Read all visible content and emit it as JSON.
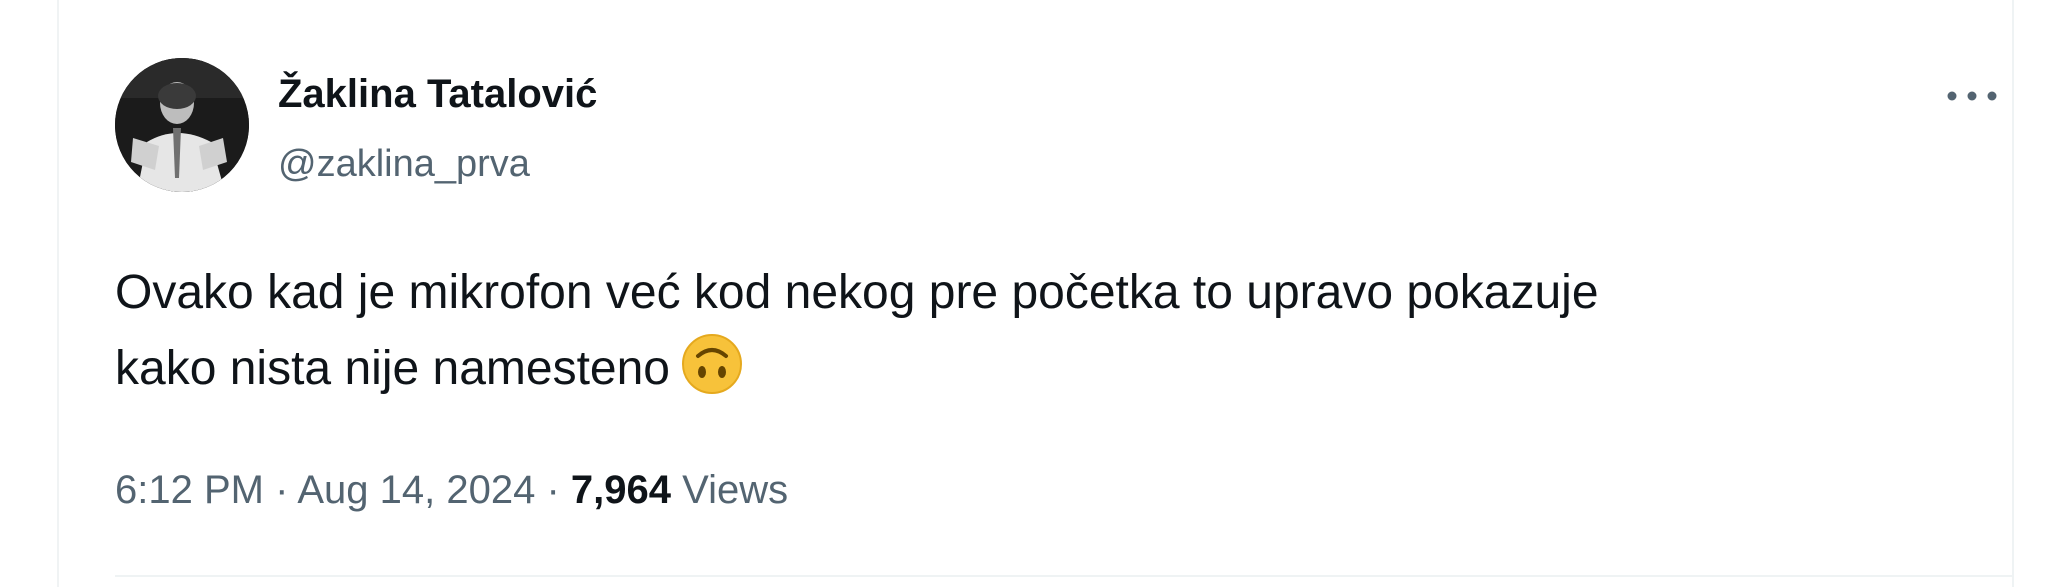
{
  "tweet": {
    "author": {
      "display_name": "Žaklina Tatalović",
      "handle": "@zaklina_prva",
      "avatar_icon": "profile-photo"
    },
    "more_icon": "more-dots-icon",
    "text_line1": "Ovako kad je mikrofon već kod nekog pre početka to upravo pokazuje",
    "text_line2": "kako nista nije namesteno",
    "emoji_icon": "upside-down-face-emoji",
    "timestamp": {
      "time": "6:12 PM",
      "separator1": "·",
      "date": "Aug 14, 2024",
      "separator2": "·",
      "views_count": "7,964",
      "views_label": "Views"
    }
  },
  "colors": {
    "text_primary": "#0f1419",
    "text_secondary": "#536471",
    "divider": "#eff3f4",
    "emoji_face": "#f7c23a"
  }
}
